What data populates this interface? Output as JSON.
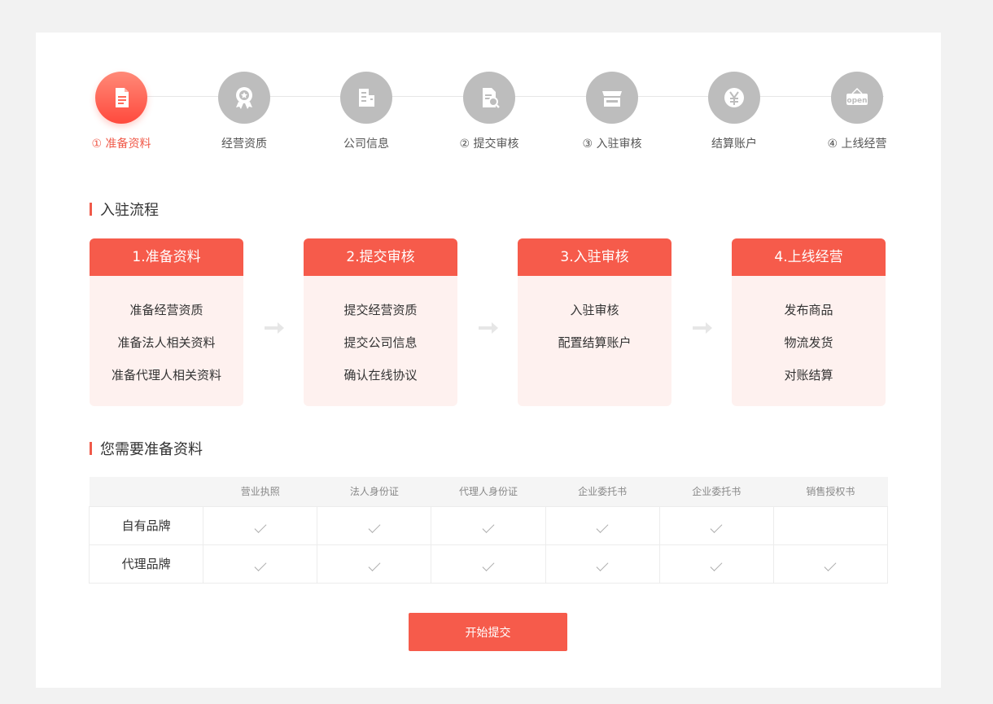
{
  "steps": [
    {
      "label": "① 准备资料",
      "icon": "document-icon",
      "active": true
    },
    {
      "label": "经营资质",
      "icon": "award-badge-icon",
      "active": false
    },
    {
      "label": "公司信息",
      "icon": "building-icon",
      "active": false
    },
    {
      "label": "② 提交审核",
      "icon": "document-search-icon",
      "active": false
    },
    {
      "label": "③ 入驻审核",
      "icon": "storefront-icon",
      "active": false
    },
    {
      "label": "结算账户",
      "icon": "yen-coin-icon",
      "active": false
    },
    {
      "label": "④ 上线经营",
      "icon": "open-sign-icon",
      "active": false
    }
  ],
  "flow": {
    "title": "入驻流程",
    "boxes": [
      {
        "title": "1.准备资料",
        "items": [
          "准备经营资质",
          "准备法人相关资料",
          "准备代理人相关资料"
        ]
      },
      {
        "title": "2.提交审核",
        "items": [
          "提交经营资质",
          "提交公司信息",
          "确认在线协议"
        ]
      },
      {
        "title": "3.入驻审核",
        "items": [
          "入驻审核",
          "配置结算账户"
        ]
      },
      {
        "title": "4.上线经营",
        "items": [
          "发布商品",
          "物流发货",
          "对账结算"
        ]
      }
    ]
  },
  "requirements": {
    "title": "您需要准备资料",
    "columns": [
      "",
      "营业执照",
      "法人身份证",
      "代理人身份证",
      "企业委托书",
      "企业委托书",
      "销售授权书"
    ],
    "rows": [
      {
        "label": "自有品牌",
        "checks": [
          true,
          true,
          true,
          true,
          true,
          false
        ]
      },
      {
        "label": "代理品牌",
        "checks": [
          true,
          true,
          true,
          true,
          true,
          true
        ]
      }
    ]
  },
  "submit_label": "开始提交",
  "colors": {
    "accent": "#f65b4b",
    "accent_light": "#fef1ef",
    "inactive_icon": "#bdbdbd"
  }
}
